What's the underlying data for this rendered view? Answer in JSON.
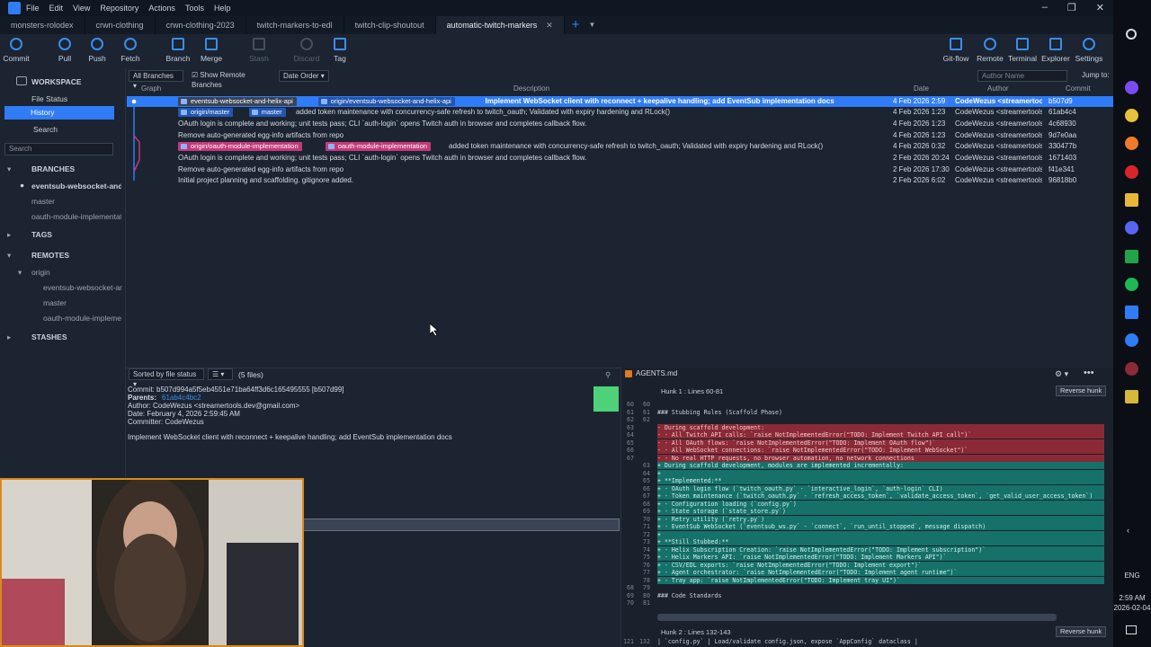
{
  "titlebar": {
    "menus": [
      "File",
      "Edit",
      "View",
      "Repository",
      "Actions",
      "Tools",
      "Help"
    ]
  },
  "tabs": [
    {
      "label": "monsters-rolodex",
      "active": false
    },
    {
      "label": "crwn-clothing",
      "active": false
    },
    {
      "label": "crwn-clothing-2023",
      "active": false
    },
    {
      "label": "twitch-markers-to-edl",
      "active": false
    },
    {
      "label": "twitch-clip-shoutout",
      "active": false
    },
    {
      "label": "automatic-twitch-markers",
      "active": true
    }
  ],
  "toolbar": {
    "left": [
      "Commit",
      "Pull",
      "Push",
      "Fetch",
      "Branch",
      "Merge",
      "Stash",
      "Discard",
      "Tag"
    ],
    "right": [
      "Git-flow",
      "Remote",
      "Terminal",
      "Explorer",
      "Settings"
    ]
  },
  "sidebar": {
    "workspace": "WORKSPACE",
    "file_status": "File Status",
    "history": "History",
    "search": "Search",
    "search_placeholder": "Search",
    "branches": "BRANCHES",
    "branch_items": [
      "eventsub-websocket-and-...",
      "master",
      "oauth-module-implementat"
    ],
    "tags": "TAGS",
    "remotes": "REMOTES",
    "origin": "origin",
    "remote_items": [
      "eventsub-websocket-an",
      "master",
      "oauth-module-impleme"
    ],
    "stashes": "STASHES"
  },
  "filters": {
    "branches": "All Branches",
    "show_remote": "Show Remote Branches",
    "order": "Date Order",
    "author_placeholder": "Author Name",
    "jump": "Jump to:"
  },
  "columns": {
    "graph": "Graph",
    "description": "Description",
    "date": "Date",
    "author": "Author",
    "commit": "Commit"
  },
  "commits": [
    {
      "badges": [
        {
          "t": "eventsub-websocket-and-helix-api",
          "c": "gray"
        },
        {
          "t": "origin/eventsub-websocket-and-helix-api",
          "c": "blue"
        }
      ],
      "desc": "Implement WebSocket client with reconnect + keepalive handling; add EventSub implementation docs",
      "date": "4 Feb 2026 2:59",
      "author": "CodeWezus <streamertoo",
      "hash": "b507d9",
      "selected": true
    },
    {
      "badges": [
        {
          "t": "origin/master",
          "c": "blue"
        },
        {
          "t": "master",
          "c": "blue"
        }
      ],
      "desc": "added token maintenance with concurrency-safe refresh to twitch_oauth; Validated with expiry hardening and RLock()",
      "date": "4 Feb 2026 1:23",
      "author": "CodeWezus <streamertools",
      "hash": "61ab4c4"
    },
    {
      "badges": [],
      "desc": "OAuth login is complete and working; unit tests pass; CLI `auth-login` opens Twitch auth in browser and completes callback flow.",
      "date": "4 Feb 2026 1:23",
      "author": "CodeWezus <streamertools",
      "hash": "4c68930"
    },
    {
      "badges": [],
      "desc": "Remove auto-generated egg-info artifacts from repo",
      "date": "4 Feb 2026 1:23",
      "author": "CodeWezus <streamertools",
      "hash": "9d7e0aa"
    },
    {
      "badges": [
        {
          "t": "origin/oauth-module-implementation",
          "c": "pink"
        },
        {
          "t": "oauth-module-implementation",
          "c": "pink"
        }
      ],
      "desc": "added token maintenance with concurrency-safe refresh to twitch_oauth; Validated with expiry hardening and RLock()",
      "date": "4 Feb 2026 0:32",
      "author": "CodeWezus <streamertools",
      "hash": "330477b"
    },
    {
      "badges": [],
      "desc": "OAuth login is complete and working; unit tests pass; CLI `auth-login` opens Twitch auth in browser and completes callback flow.",
      "date": "2 Feb 2026 20:24",
      "author": "CodeWezus <streamertools",
      "hash": "1671403"
    },
    {
      "badges": [],
      "desc": "Remove auto-generated egg-info artifacts from repo",
      "date": "2 Feb 2026 17:30",
      "author": "CodeWezus <streamertools",
      "hash": "f41e341"
    },
    {
      "badges": [],
      "desc": "Initial project planning and scaffolding. gitignore added.",
      "date": "2 Feb 2026 6:02",
      "author": "CodeWezus <streamertools",
      "hash": "96818b0"
    }
  ],
  "files_bar": {
    "sort": "Sorted by file status",
    "count": "(5 files)",
    "filename": "AGENTS.md"
  },
  "details": {
    "commit": "Commit: b507d994a5f5eb4551e71ba64ff3d6c165495555 [b507d99]",
    "parents_label": "Parents:",
    "parents_value": "61ab4c4bc2",
    "author": "Author: CodeWezus <streamertools.dev@gmail.com>",
    "date": "Date: February 4, 2026 2:59:45 AM",
    "committer": "Committer: CodeWezus",
    "message": "Implement WebSocket client with reconnect + keepalive handling; add EventSub implementation docs"
  },
  "diff": {
    "hunk1": "Hunk 1 : Lines 60-81",
    "hunk2": "Hunk 2 : Lines 132-143",
    "reverse": "Reverse hunk",
    "lines": [
      {
        "o": "60",
        "n": "60",
        "t": "",
        "k": "ctx"
      },
      {
        "o": "61",
        "n": "61",
        "t": "### Stubbing Rules (Scaffold Phase)",
        "k": "ctx"
      },
      {
        "o": "62",
        "n": "62",
        "t": "",
        "k": "ctx"
      },
      {
        "o": "63",
        "n": "",
        "t": "- During scaffold development:",
        "k": "del"
      },
      {
        "o": "64",
        "n": "",
        "t": "- - All Twitch API calls: `raise NotImplementedError(\"TODO: Implement Twitch API call\")`",
        "k": "del"
      },
      {
        "o": "65",
        "n": "",
        "t": "- - All OAuth flows: `raise NotImplementedError(\"TODO: Implement OAuth flow\")`",
        "k": "del"
      },
      {
        "o": "66",
        "n": "",
        "t": "- - All WebSocket connections: `raise NotImplementedError(\"TODO: Implement WebSocket\")`",
        "k": "del"
      },
      {
        "o": "67",
        "n": "",
        "t": "- - No real HTTP requests, no browser automation, no network connections",
        "k": "del"
      },
      {
        "o": "",
        "n": "63",
        "t": "+ During scaffold development, modules are implemented incrementally:",
        "k": "add"
      },
      {
        "o": "",
        "n": "64",
        "t": "+",
        "k": "add"
      },
      {
        "o": "",
        "n": "65",
        "t": "+ **Implemented:**",
        "k": "add"
      },
      {
        "o": "",
        "n": "66",
        "t": "+ - OAuth login flow (`twitch_oauth.py` - `interactive_login`, `auth-login` CLI)",
        "k": "add"
      },
      {
        "o": "",
        "n": "67",
        "t": "+ - Token maintenance (`twitch_oauth.py` - `refresh_access_token`, `validate_access_token`, `get_valid_user_access_token`)",
        "k": "add"
      },
      {
        "o": "",
        "n": "68",
        "t": "+ - Configuration loading (`config.py`)",
        "k": "add"
      },
      {
        "o": "",
        "n": "69",
        "t": "+ - State storage (`state_store.py`)",
        "k": "add"
      },
      {
        "o": "",
        "n": "70",
        "t": "+ - Retry utility (`retry.py`)",
        "k": "add"
      },
      {
        "o": "",
        "n": "71",
        "t": "+ - EventSub WebSocket (`eventsub_ws.py` - `connect`, `run_until_stopped`, message dispatch)",
        "k": "add"
      },
      {
        "o": "",
        "n": "72",
        "t": "+",
        "k": "add"
      },
      {
        "o": "",
        "n": "73",
        "t": "+ **Still Stubbed:**",
        "k": "add"
      },
      {
        "o": "",
        "n": "74",
        "t": "+ - Helix Subscription Creation: `raise NotImplementedError(\"TODO: Implement subscription\")`",
        "k": "add"
      },
      {
        "o": "",
        "n": "75",
        "t": "+ - Helix Markers API: `raise NotImplementedError(\"TODO: Implement Markers API\")`",
        "k": "add"
      },
      {
        "o": "",
        "n": "76",
        "t": "+ - CSV/EDL exports: `raise NotImplementedError(\"TODO: Implement export\")`",
        "k": "add"
      },
      {
        "o": "",
        "n": "77",
        "t": "+ - Agent orchestrator: `raise NotImplementedError(\"TODO: Implement agent runtime\")`",
        "k": "add"
      },
      {
        "o": "",
        "n": "78",
        "t": "+ - Tray app: `raise NotImplementedError(\"TODO: Implement tray UI\")`",
        "k": "add"
      },
      {
        "o": "68",
        "n": "79",
        "t": "",
        "k": "ctx"
      },
      {
        "o": "69",
        "n": "80",
        "t": "### Code Standards",
        "k": "ctx"
      },
      {
        "o": "70",
        "n": "81",
        "t": "",
        "k": "ctx"
      }
    ],
    "last_line": {
      "o": "121",
      "n": "132",
      "t": "| `config.py` | Load/validate config.json, expose `AppConfig` dataclass |"
    }
  },
  "taskbar": {
    "lang": "ENG",
    "time": "2:59 AM",
    "date": "2026-02-04"
  },
  "colors": {
    "accent": "#2f7cf6",
    "deleted": "#8a2a36",
    "added": "#15716a",
    "branch_pink": "#c2397a",
    "webcam_border": "#d98a1c"
  }
}
